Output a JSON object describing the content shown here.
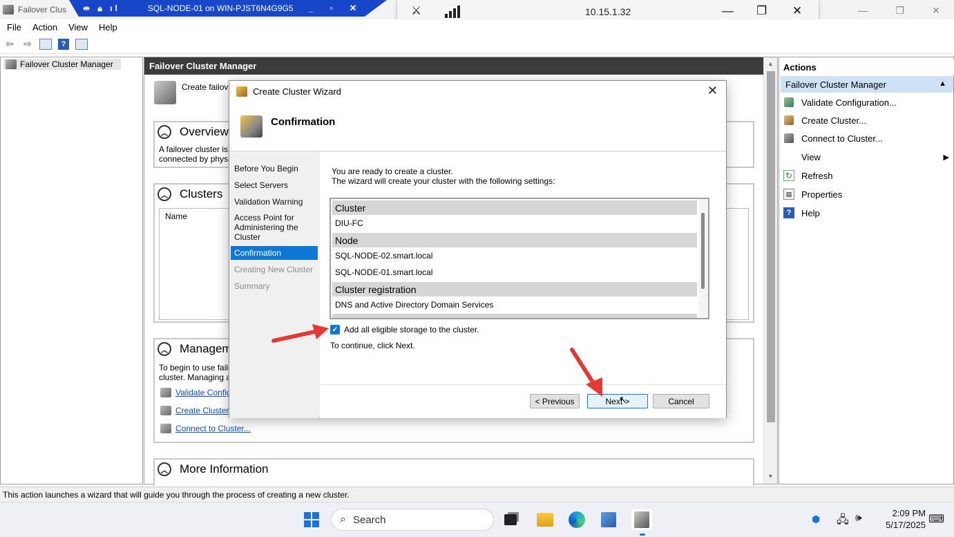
{
  "window": {
    "app_title": "Failover Clus",
    "rdp_title": "SQL-NODE-01 on WIN-PJST6N4G9G5",
    "connection_ip": "10.15.1.32"
  },
  "menu": [
    "File",
    "Action",
    "View",
    "Help"
  ],
  "tree": {
    "root": "Failover Cluster Manager"
  },
  "center": {
    "header": "Failover Cluster Manager",
    "intro_text": "Create failov",
    "overview": {
      "title": "Overview",
      "line1": "A failover cluster is",
      "line2": "connected by physi"
    },
    "clusters": {
      "title": "Clusters",
      "col_name": "Name"
    },
    "management": {
      "title": "Managem",
      "line1": "To begin to use faile",
      "line2": "cluster. Managing a",
      "links": [
        "Validate Configu",
        "Create Cluster...",
        "Connect to Cluster..."
      ]
    },
    "more_info": {
      "title": "More Information"
    }
  },
  "actions": {
    "header": "Actions",
    "sub_header": "Failover Cluster Manager",
    "items": [
      "Validate Configuration...",
      "Create Cluster...",
      "Connect to Cluster...",
      "View",
      "Refresh",
      "Properties",
      "Help"
    ]
  },
  "status_bar": "This action launches a wizard that will guide you through the process of creating a new cluster.",
  "taskbar": {
    "search_placeholder": "Search",
    "time": "2:09 PM",
    "date": "5/17/2025"
  },
  "wizard": {
    "title": "Create Cluster Wizard",
    "page_title": "Confirmation",
    "steps": [
      "Before You Begin",
      "Select Servers",
      "Validation Warning",
      "Access Point for Administering the Cluster",
      "Confirmation",
      "Creating New Cluster",
      "Summary"
    ],
    "active_step": "Confirmation",
    "intro_line1": "You are ready to create a cluster.",
    "intro_line2": "The wizard will create your cluster with the following settings:",
    "settings": {
      "cluster_label": "Cluster",
      "cluster_value": "DIU-FC",
      "node_label": "Node",
      "node_1": "SQL-NODE-02.smart.local",
      "node_2": "SQL-NODE-01.smart.local",
      "registration_label": "Cluster registration",
      "registration_value": "DNS and Active Directory Domain Services"
    },
    "add_storage_label": "Add all eligible storage to the cluster.",
    "add_storage_checked": true,
    "continue_text": "To continue, click Next.",
    "buttons": {
      "previous": "< Previous",
      "next": "Next >",
      "cancel": "Cancel"
    }
  },
  "colors": {
    "rdp_bar": "#1747c8",
    "selection": "#0f78d4",
    "annotation_arrow": "#e53935",
    "header_dark": "#3c3c3c"
  }
}
